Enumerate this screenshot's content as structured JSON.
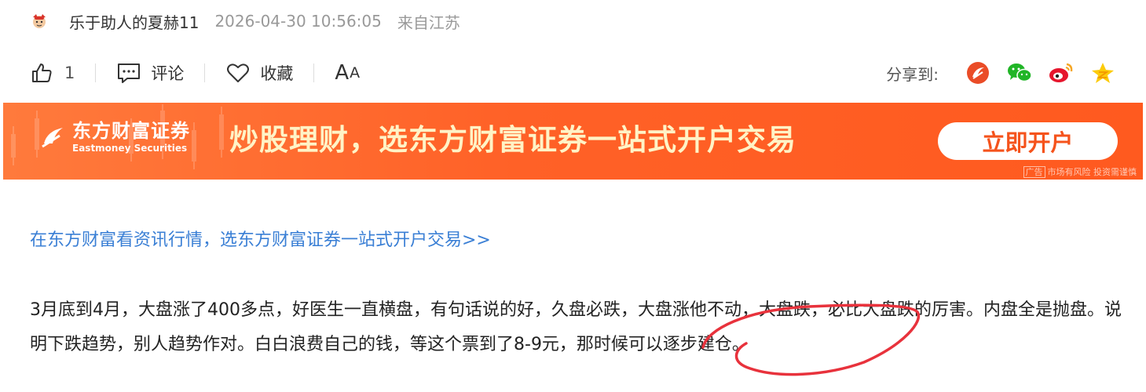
{
  "post": {
    "username": "乐于助人的夏赫11",
    "timestamp": "2026-04-30 10:56:05",
    "location": "来自江苏"
  },
  "actions": {
    "like_count": "1",
    "comment_label": "评论",
    "favorite_label": "收藏",
    "font_big": "A",
    "font_small": "A"
  },
  "share": {
    "label": "分享到:",
    "icons": [
      "eastmoney-guba-icon",
      "wechat-icon",
      "weibo-icon",
      "qzone-icon"
    ]
  },
  "banner": {
    "brand_cn": "东方财富证券",
    "brand_en": "Eastmoney Securities",
    "slogan": "炒股理财，选东方财富证券一站式开户交易",
    "cta_label": "立即开户",
    "ad_tag": "广告",
    "ad_disclaimer": "市场有风险 投资需谨慎"
  },
  "promo_link": "在东方财富看资讯行情，选东方财富证券一站式开户交易>>",
  "content": "3月底到4月，大盘涨了400多点，好医生一直横盘，有句话说的好，久盘必跌，大盘涨他不动，大盘跌，必比大盘跌的厉害。内盘全是抛盘。说明下跌趋势，别人趋势作对。白白浪费自己的钱，等这个票到了8-9元，那时候可以逐步建仓。",
  "colors": {
    "banner": "#ff6127",
    "link": "#3a7fd5",
    "annotation": "#e8323c"
  }
}
